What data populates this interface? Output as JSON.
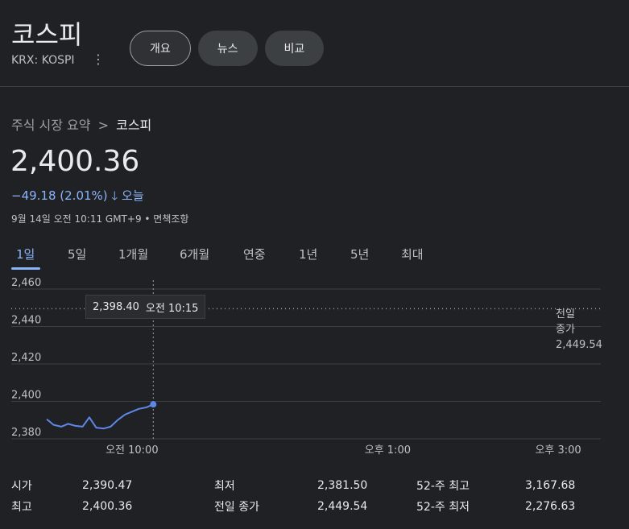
{
  "header": {
    "title": "코스피",
    "ticker": "KRX: KOSPI",
    "tabs": [
      {
        "label": "개요",
        "active": true
      },
      {
        "label": "뉴스",
        "active": false
      },
      {
        "label": "비교",
        "active": false
      }
    ]
  },
  "breadcrumb": {
    "parent": "주식 시장 요약",
    "separator": ">",
    "current": "코스피"
  },
  "quote": {
    "price": "2,400.36",
    "change": "−49.18 (2.01%)",
    "change_direction": "down",
    "period": "오늘",
    "timestamp": "9월 14일 오전 10:11 GMT+9 • 면책조항"
  },
  "ranges": [
    "1일",
    "5일",
    "1개월",
    "6개월",
    "연중",
    "1년",
    "5년",
    "최대"
  ],
  "active_range": "1일",
  "tooltip": {
    "value": "2,398.40",
    "time": "오전 10:15"
  },
  "previous_close": {
    "label_line1": "전일",
    "label_line2": "종가",
    "value": "2,449.54"
  },
  "chart_data": {
    "type": "line",
    "y_ticks": [
      "2,460",
      "2,440",
      "2,420",
      "2,400",
      "2,380"
    ],
    "x_ticks": [
      "오전 10:00",
      "오후 1:00",
      "오후 3:00"
    ],
    "ylim": [
      2380,
      2460
    ],
    "xlim_hours": [
      9.0,
      15.5
    ],
    "previous_close": 2449.54,
    "x": [
      9.0,
      9.08,
      9.17,
      9.25,
      9.33,
      9.42,
      9.5,
      9.58,
      9.67,
      9.75,
      9.83,
      9.92,
      10.0,
      10.08,
      10.17,
      10.25
    ],
    "values": [
      2390.5,
      2387.5,
      2386.5,
      2388.0,
      2387.0,
      2386.5,
      2391.5,
      2386.0,
      2385.5,
      2386.5,
      2390.0,
      2393.0,
      2394.5,
      2396.0,
      2396.8,
      2398.4
    ],
    "line_color": "#5f87e8",
    "grid": true
  },
  "stats": [
    [
      {
        "label": "시가",
        "value": "2,390.47"
      },
      {
        "label": "최저",
        "value": "2,381.50"
      },
      {
        "label": "52-주 최고",
        "value": "3,167.68"
      }
    ],
    [
      {
        "label": "최고",
        "value": "2,400.36"
      },
      {
        "label": "전일 종가",
        "value": "2,449.54"
      },
      {
        "label": "52-주 최저",
        "value": "2,276.63"
      }
    ]
  ]
}
